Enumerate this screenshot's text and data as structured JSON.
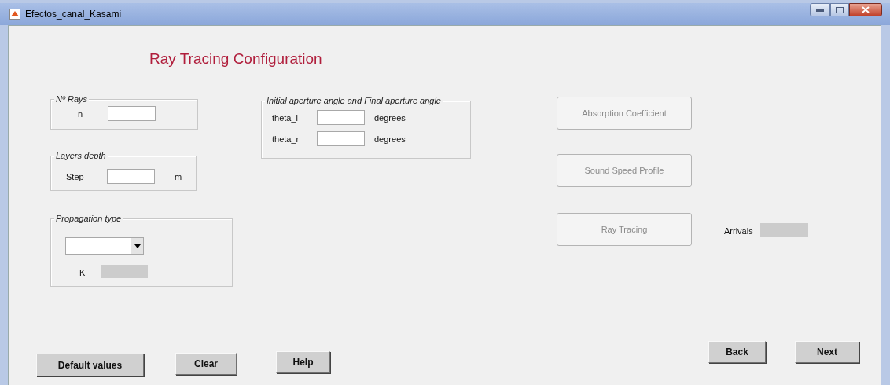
{
  "window": {
    "title": "Efectos_canal_Kasami"
  },
  "heading": "Ray Tracing Configuration",
  "panels": [
    {
      "title": "Nº Rays",
      "fields": [
        {
          "label": "n"
        }
      ]
    },
    {
      "title": "Layers depth",
      "fields": [
        {
          "label": "Step",
          "unit": "m"
        }
      ]
    },
    {
      "title": "Initial aperture angle and Final aperture angle",
      "fields": [
        {
          "label": "theta_i",
          "unit": "degrees"
        },
        {
          "label": "theta_r",
          "unit": "degrees"
        }
      ]
    }
  ],
  "propagation": {
    "title": "Propagation type",
    "k_label": "K",
    "k_disabled": true
  },
  "action_buttons": [
    {
      "label": "Absorption Coefficient",
      "disabled": true
    },
    {
      "label": "Sound Speed Profile",
      "disabled": true
    },
    {
      "label": "Ray Tracing",
      "disabled": true
    }
  ],
  "arrivals": {
    "label": "Arrivals",
    "disabled": true
  },
  "bottom_buttons": [
    {
      "label": "Default values"
    },
    {
      "label": "Clear"
    },
    {
      "label": "Help"
    },
    {
      "label": "Back"
    },
    {
      "label": "Next"
    }
  ]
}
